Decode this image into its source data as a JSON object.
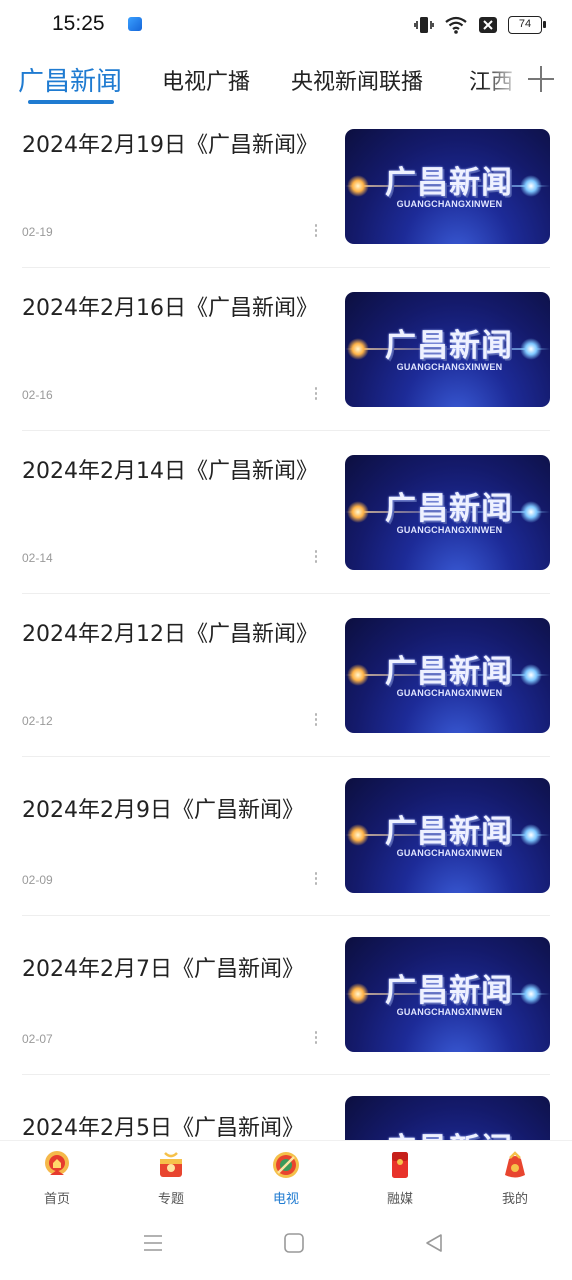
{
  "status_bar": {
    "time": "15:25",
    "battery": "74"
  },
  "tabs": [
    {
      "label": "广昌新闻",
      "active": true
    },
    {
      "label": "电视广播",
      "active": false
    },
    {
      "label": "央视新闻联播",
      "active": false
    },
    {
      "label": "江西",
      "active": false
    }
  ],
  "news": [
    {
      "title": "2024年2月19日《广昌新闻》",
      "date": "02-19",
      "thumb_title": "广昌新闻",
      "thumb_sub": "GUANGCHANGXINWEN"
    },
    {
      "title": "2024年2月16日《广昌新闻》",
      "date": "02-16",
      "thumb_title": "广昌新闻",
      "thumb_sub": "GUANGCHANGXINWEN"
    },
    {
      "title": "2024年2月14日《广昌新闻》",
      "date": "02-14",
      "thumb_title": "广昌新闻",
      "thumb_sub": "GUANGCHANGXINWEN"
    },
    {
      "title": "2024年2月12日《广昌新闻》",
      "date": "02-12",
      "thumb_title": "广昌新闻",
      "thumb_sub": "GUANGCHANGXINWEN"
    },
    {
      "title": "2024年2月9日《广昌新闻》",
      "date": "02-09",
      "thumb_title": "广昌新闻",
      "thumb_sub": "GUANGCHANGXINWEN"
    },
    {
      "title": "2024年2月7日《广昌新闻》",
      "date": "02-07",
      "thumb_title": "广昌新闻",
      "thumb_sub": "GUANGCHANGXINWEN"
    },
    {
      "title": "2024年2月5日《广昌新闻》",
      "date": "",
      "thumb_title": "广昌新闻",
      "thumb_sub": ""
    }
  ],
  "bottom_nav": [
    {
      "label": "首页",
      "icon": "home-icon",
      "active": false
    },
    {
      "label": "专题",
      "icon": "topic-icon",
      "active": false
    },
    {
      "label": "电视",
      "icon": "tv-icon",
      "active": true
    },
    {
      "label": "融媒",
      "icon": "media-icon",
      "active": false
    },
    {
      "label": "我的",
      "icon": "profile-icon",
      "active": false
    }
  ],
  "colors": {
    "accent": "#1f7bd1",
    "text": "#222222",
    "muted": "#9a9a9a"
  }
}
